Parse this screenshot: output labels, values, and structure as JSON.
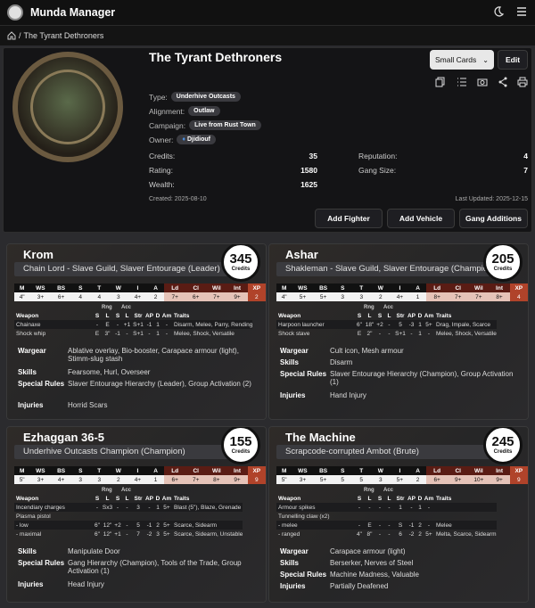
{
  "app": {
    "title": "Munda Manager"
  },
  "breadcrumb": {
    "current": "The Tyrant Dethroners"
  },
  "gang": {
    "name": "The Tyrant Dethroners",
    "type_label": "Type:",
    "type": "Underhive Outcasts",
    "alignment_label": "Alignment:",
    "alignment": "Outlaw",
    "campaign_label": "Campaign:",
    "campaign": "Live from Rust Town",
    "owner_label": "Owner:",
    "owner": "Djidiouf",
    "credits_label": "Credits:",
    "credits": "35",
    "rating_label": "Rating:",
    "rating": "1580",
    "wealth_label": "Wealth:",
    "wealth": "1625",
    "reputation_label": "Reputation:",
    "reputation": "4",
    "size_label": "Gang Size:",
    "size": "7",
    "created": "Created: 2025-08-10",
    "updated": "Last Updated: 2025-12-15"
  },
  "controls": {
    "view_select": "Small Cards",
    "edit": "Edit",
    "add_fighter": "Add Fighter",
    "add_vehicle": "Add Vehicle",
    "gang_additions": "Gang Additions"
  },
  "colors": {
    "accent": "#b0432a",
    "leadership": "#5a1c14"
  },
  "stat_headers": [
    "M",
    "WS",
    "BS",
    "S",
    "T",
    "W",
    "I",
    "A",
    "Ld",
    "Cl",
    "Wil",
    "Int",
    "XP"
  ],
  "weapon_headers": {
    "weapon": "Weapon",
    "s": "S",
    "l": "L",
    "s2": "S",
    "l2": "L",
    "str": "Str",
    "ap": "AP",
    "d": "D",
    "am": "Am",
    "traits": "Traits",
    "rng": "Rng",
    "acc": "Acc"
  },
  "labels": {
    "credits": "Credits",
    "wargear": "Wargear",
    "skills": "Skills",
    "special": "Special Rules",
    "injuries": "Injuries"
  },
  "fighters": [
    {
      "name": "Krom",
      "type": "Chain Lord - Slave Guild, Slaver Entourage (Leader)",
      "cost": "345",
      "stats": [
        "4\"",
        "3+",
        "6+",
        "4",
        "4",
        "3",
        "4+",
        "2",
        "7+",
        "6+",
        "7+",
        "9+",
        "2"
      ],
      "weapons": [
        {
          "name": "Chainaxe",
          "s": "-",
          "l": "E",
          "s2": "-",
          "l2": "+1",
          "str": "S+1",
          "ap": "-1",
          "d": "1",
          "am": "-",
          "traits": "Disarm, Melee, Parry, Rending"
        },
        {
          "name": "Shock whip",
          "s": "E",
          "l": "3\"",
          "s2": "-1",
          "l2": "-",
          "str": "S+1",
          "ap": "-",
          "d": "1",
          "am": "-",
          "traits": "Melee, Shock, Versatile"
        }
      ],
      "wargear": "Ablative overlay, Bio-booster, Carapace armour (light), Stimm-slug stash",
      "skills": "Fearsome, Hurl, Overseer",
      "special": "Slaver Entourage Hierarchy (Leader), Group Activation (2)",
      "injuries": "Horrid Scars"
    },
    {
      "name": "Ashar",
      "type": "Shakleman - Slave Guild, Slaver Entourage (Champion)",
      "cost": "205",
      "stats": [
        "4\"",
        "5+",
        "5+",
        "3",
        "3",
        "2",
        "4+",
        "1",
        "8+",
        "7+",
        "7+",
        "8+",
        "4"
      ],
      "weapons": [
        {
          "name": "Harpoon launcher",
          "s": "6\"",
          "l": "18\"",
          "s2": "+2",
          "l2": "-",
          "str": "5",
          "ap": "-3",
          "d": "1",
          "am": "5+",
          "traits": "Drag, Impale, Scarce"
        },
        {
          "name": "Shock stave",
          "s": "E",
          "l": "2\"",
          "s2": "-",
          "l2": "-",
          "str": "S+1",
          "ap": "-",
          "d": "1",
          "am": "-",
          "traits": "Melee, Shock, Versatile"
        }
      ],
      "wargear": "Cult icon, Mesh armour",
      "skills": "Disarm",
      "special": "Slaver Entourage Hierarchy (Champion), Group Activation (1)",
      "injuries": "Hand Injury"
    },
    {
      "name": "Ezhaggan 36-5",
      "type": "Underhive Outcasts Champion (Champion)",
      "cost": "155",
      "stats": [
        "5\"",
        "3+",
        "4+",
        "3",
        "3",
        "2",
        "4+",
        "1",
        "6+",
        "7+",
        "8+",
        "9+",
        "9"
      ],
      "weapons": [
        {
          "name": "Incendiary charges",
          "s": "-",
          "l": "Sx3",
          "s2": "-",
          "l2": "-",
          "str": "3",
          "ap": "-",
          "d": "1",
          "am": "5+",
          "traits": "Blast (5\"), Blaze, Grenade"
        },
        {
          "name": "Plasma pistol",
          "s": "",
          "l": "",
          "s2": "",
          "l2": "",
          "str": "",
          "ap": "",
          "d": "",
          "am": "",
          "traits": ""
        },
        {
          "name": "- low",
          "s": "6\"",
          "l": "12\"",
          "s2": "+2",
          "l2": "-",
          "str": "5",
          "ap": "-1",
          "d": "2",
          "am": "5+",
          "traits": "Scarce, Sidearm"
        },
        {
          "name": "- maximal",
          "s": "6\"",
          "l": "12\"",
          "s2": "+1",
          "l2": "-",
          "str": "7",
          "ap": "-2",
          "d": "3",
          "am": "5+",
          "traits": "Scarce, Sidearm, Unstable"
        }
      ],
      "skills": "Manipulate Door",
      "special": "Gang Hierarchy (Champion), Tools of the Trade, Group Activation (1)",
      "injuries": "Head Injury"
    },
    {
      "name": "The Machine",
      "type": "Scrapcode-corrupted Ambot (Brute)",
      "cost": "245",
      "stats": [
        "5\"",
        "3+",
        "5+",
        "5",
        "5",
        "3",
        "5+",
        "2",
        "6+",
        "9+",
        "10+",
        "9+",
        "9"
      ],
      "weapons": [
        {
          "name": "Armour spikes",
          "s": "-",
          "l": "-",
          "s2": "-",
          "l2": "-",
          "str": "1",
          "ap": "-",
          "d": "1",
          "am": "-",
          "traits": ""
        },
        {
          "name": "Tunnelling claw (x2)",
          "s": "",
          "l": "",
          "s2": "",
          "l2": "",
          "str": "",
          "ap": "",
          "d": "",
          "am": "",
          "traits": ""
        },
        {
          "name": "- melee",
          "s": "-",
          "l": "E",
          "s2": "-",
          "l2": "-",
          "str": "S",
          "ap": "-1",
          "d": "2",
          "am": "-",
          "traits": "Melee"
        },
        {
          "name": "- ranged",
          "s": "4\"",
          "l": "8\"",
          "s2": "-",
          "l2": "-",
          "str": "6",
          "ap": "-2",
          "d": "2",
          "am": "5+",
          "traits": "Melta, Scarce, Sidearm"
        }
      ],
      "wargear": "Carapace armour (light)",
      "skills": "Berserker, Nerves of Steel",
      "special": "Machine Madness, Valuable",
      "injuries": "Partially Deafened"
    }
  ]
}
